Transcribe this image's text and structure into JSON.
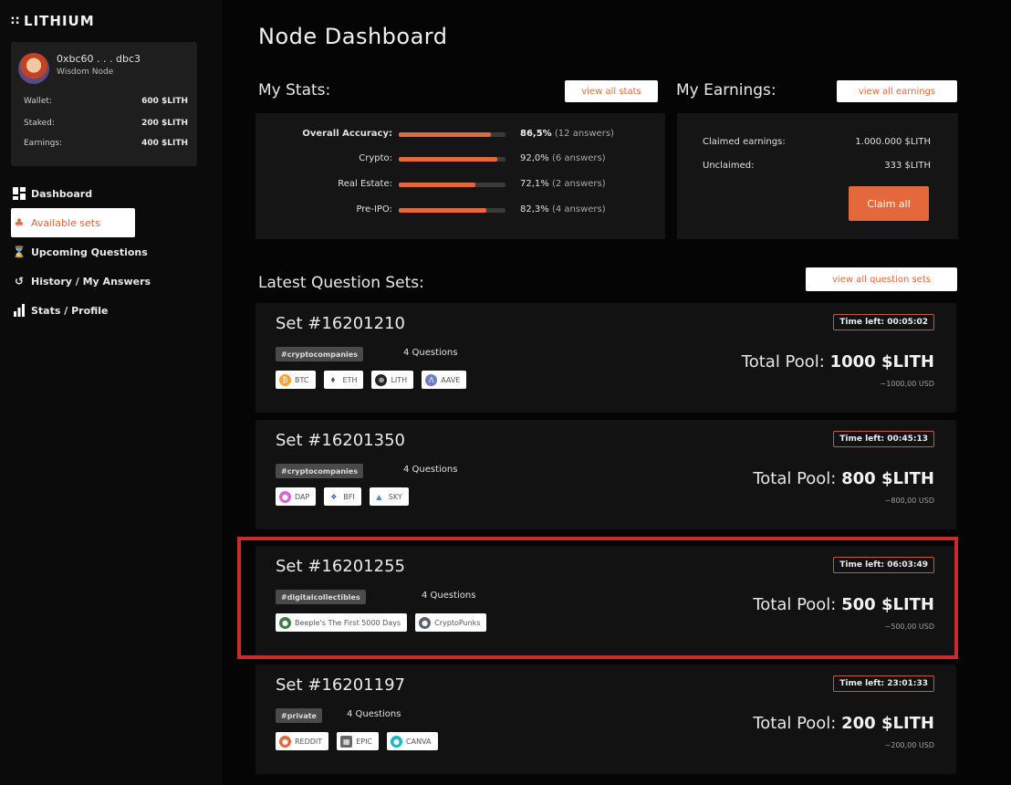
{
  "app": {
    "name": "LITHIUM"
  },
  "profile": {
    "address": "0xbc60 . . . dbc3",
    "node_type": "Wisdom Node",
    "rows": [
      {
        "label": "Wallet:",
        "value": "600 $LITH"
      },
      {
        "label": "Staked:",
        "value": "200 $LITH"
      },
      {
        "label": "Earnings:",
        "value": "400 $LITH"
      }
    ]
  },
  "nav": [
    {
      "label": "Dashboard",
      "icon": "dashboard-icon"
    },
    {
      "label": "Available sets",
      "icon": "sets-icon"
    },
    {
      "label": "Upcoming Questions",
      "icon": "hourglass-icon"
    },
    {
      "label": "History / My Answers",
      "icon": "history-icon"
    },
    {
      "label": "Stats / Profile",
      "icon": "bar-chart-icon"
    }
  ],
  "page": {
    "title": "Node Dashboard"
  },
  "stats": {
    "title": "My Stats:",
    "view_all": "view all stats",
    "rows": [
      {
        "label": "Overall Accuracy:",
        "pct": "86,5%",
        "answers": "(12 answers)",
        "fill": 0.865
      },
      {
        "label": "Crypto:",
        "pct": "92,0%",
        "answers": "(6 answers)",
        "fill": 0.92
      },
      {
        "label": "Real Estate:",
        "pct": "72,1%",
        "answers": "(2 answers)",
        "fill": 0.721
      },
      {
        "label": "Pre-IPO:",
        "pct": "82,3%",
        "answers": "(4 answers)",
        "fill": 0.823
      }
    ]
  },
  "earnings": {
    "title": "My Earnings:",
    "view_all": "view all earnings",
    "claimed_label": "Claimed earnings:",
    "claimed_value": "1.000.000 $LITH",
    "unclaimed_label": "Unclaimed:",
    "unclaimed_value": "333 $LITH",
    "claim_button": "Claim all"
  },
  "sets": {
    "title": "Latest Question Sets:",
    "view_all": "view all question sets",
    "items": [
      {
        "name": "Set #16201210",
        "tag": "#cryptocompanies",
        "questions": "4 Questions",
        "chips": [
          {
            "label": "BTC",
            "icon": "bitcoin-icon",
            "color": "#f2a33a"
          },
          {
            "label": "ETH",
            "icon": "ethereum-icon",
            "color": "#555555"
          },
          {
            "label": "LITH",
            "icon": "lithium-icon",
            "color": "#222222"
          },
          {
            "label": "AAVE",
            "icon": "aave-icon",
            "color": "#6b7fc2"
          }
        ],
        "time_left": "Time left: 00:05:02",
        "pool_label": "Total Pool:",
        "pool_value": "1000 $LITH",
        "usd": "~1000,00 USD"
      },
      {
        "name": "Set #16201350",
        "tag": "#cryptocompanies",
        "questions": "4 Questions",
        "chips": [
          {
            "label": "DAP",
            "icon": "dap-icon",
            "color": "#d36ad0"
          },
          {
            "label": "BFI",
            "icon": "bfi-icon",
            "color": "#2b5fb8"
          },
          {
            "label": "SKY",
            "icon": "sky-icon",
            "color": "#3a8fd6"
          }
        ],
        "time_left": "Time left: 00:45:13",
        "pool_label": "Total Pool:",
        "pool_value": "800 $LITH",
        "usd": "~800,00 USD"
      },
      {
        "name": "Set #16201255",
        "tag": "#digitalcollectibles",
        "questions": "4 Questions",
        "chips": [
          {
            "label": "Beeple's The First 5000 Days",
            "icon": "beeple-icon",
            "color": "#3f7a4a"
          },
          {
            "label": "CryptoPunks",
            "icon": "cryptopunks-icon",
            "color": "#5a6470"
          }
        ],
        "time_left": "Time left: 06:03:49",
        "pool_label": "Total Pool:",
        "pool_value": "500 $LITH",
        "usd": "~500,00 USD"
      },
      {
        "name": "Set #16201197",
        "tag": "#private",
        "questions": "4 Questions",
        "chips": [
          {
            "label": "REDDIT",
            "icon": "reddit-icon",
            "color": "#e4683b"
          },
          {
            "label": "EPIC",
            "icon": "epic-icon",
            "color": "#666666"
          },
          {
            "label": "CANVA",
            "icon": "canva-icon",
            "color": "#1fb3c9"
          }
        ],
        "time_left": "Time left: 23:01:33",
        "pool_label": "Total Pool:",
        "pool_value": "200 $LITH",
        "usd": "~200,00 USD"
      }
    ]
  },
  "colors": {
    "accent": "#e4683b",
    "highlight": "#c92a2a",
    "background": "#050505"
  }
}
